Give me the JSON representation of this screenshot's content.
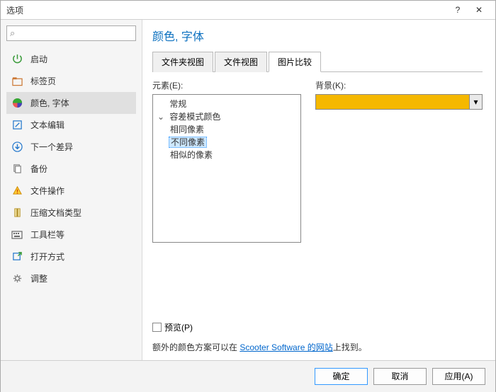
{
  "window": {
    "title": "选项",
    "help": "?",
    "close": "✕"
  },
  "search": {
    "placeholder": ""
  },
  "sidebar": {
    "items": [
      {
        "label": "启动"
      },
      {
        "label": "标签页"
      },
      {
        "label": "颜色, 字体"
      },
      {
        "label": "文本编辑"
      },
      {
        "label": "下一个差异"
      },
      {
        "label": "备份"
      },
      {
        "label": "文件操作"
      },
      {
        "label": "压缩文档类型"
      },
      {
        "label": "工具栏等"
      },
      {
        "label": "打开方式"
      },
      {
        "label": "调整"
      }
    ]
  },
  "page": {
    "title": "颜色, 字体",
    "tabs": [
      {
        "label": "文件夹视图"
      },
      {
        "label": "文件视图"
      },
      {
        "label": "图片比较"
      }
    ],
    "elements_label": "元素(E):",
    "background_label": "背景(K):",
    "background_color": "#f5b800",
    "tree": {
      "root1": "常规",
      "root2": "容差模式颜色",
      "children": [
        {
          "label": "相同像素"
        },
        {
          "label": "不同像素"
        },
        {
          "label": "相似的像素"
        }
      ],
      "expand": "⌄"
    },
    "preview_label": "预览(P)",
    "footer_prefix": "额外的颜色方案可以在 ",
    "footer_link": "Scooter Software 的网站",
    "footer_suffix": "上找到。"
  },
  "buttons": {
    "ok": "确定",
    "cancel": "取消",
    "apply": "应用(A)"
  }
}
